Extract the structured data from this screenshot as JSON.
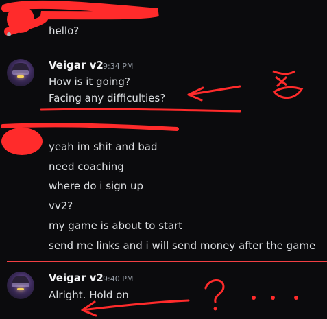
{
  "messages": {
    "first": {
      "lines": [
        "hello?"
      ]
    },
    "veigar_1": {
      "author": "Veigar v2",
      "time": "9:34 PM",
      "lines": [
        "How is it going?",
        "Facing any difficulties?"
      ]
    },
    "user_group": {
      "lines": [
        "yeah im shit and bad",
        "need coaching",
        "where do i sign up",
        "vv2?",
        "my game is about to start",
        "send me links and i will send money after the game"
      ]
    },
    "veigar_2": {
      "author": "Veigar v2",
      "time": "9:40 PM",
      "lines": [
        "Alright. Hold on"
      ]
    }
  },
  "colors": {
    "background": "#0b0b0d",
    "text": "#dbdee1",
    "username": "#f2f3f5",
    "timestamp": "#949ba4",
    "new_divider": "#f23f43",
    "annotation_red": "#ff2b2b"
  },
  "icons": {
    "avatar": "veigar-avatar-icon"
  }
}
